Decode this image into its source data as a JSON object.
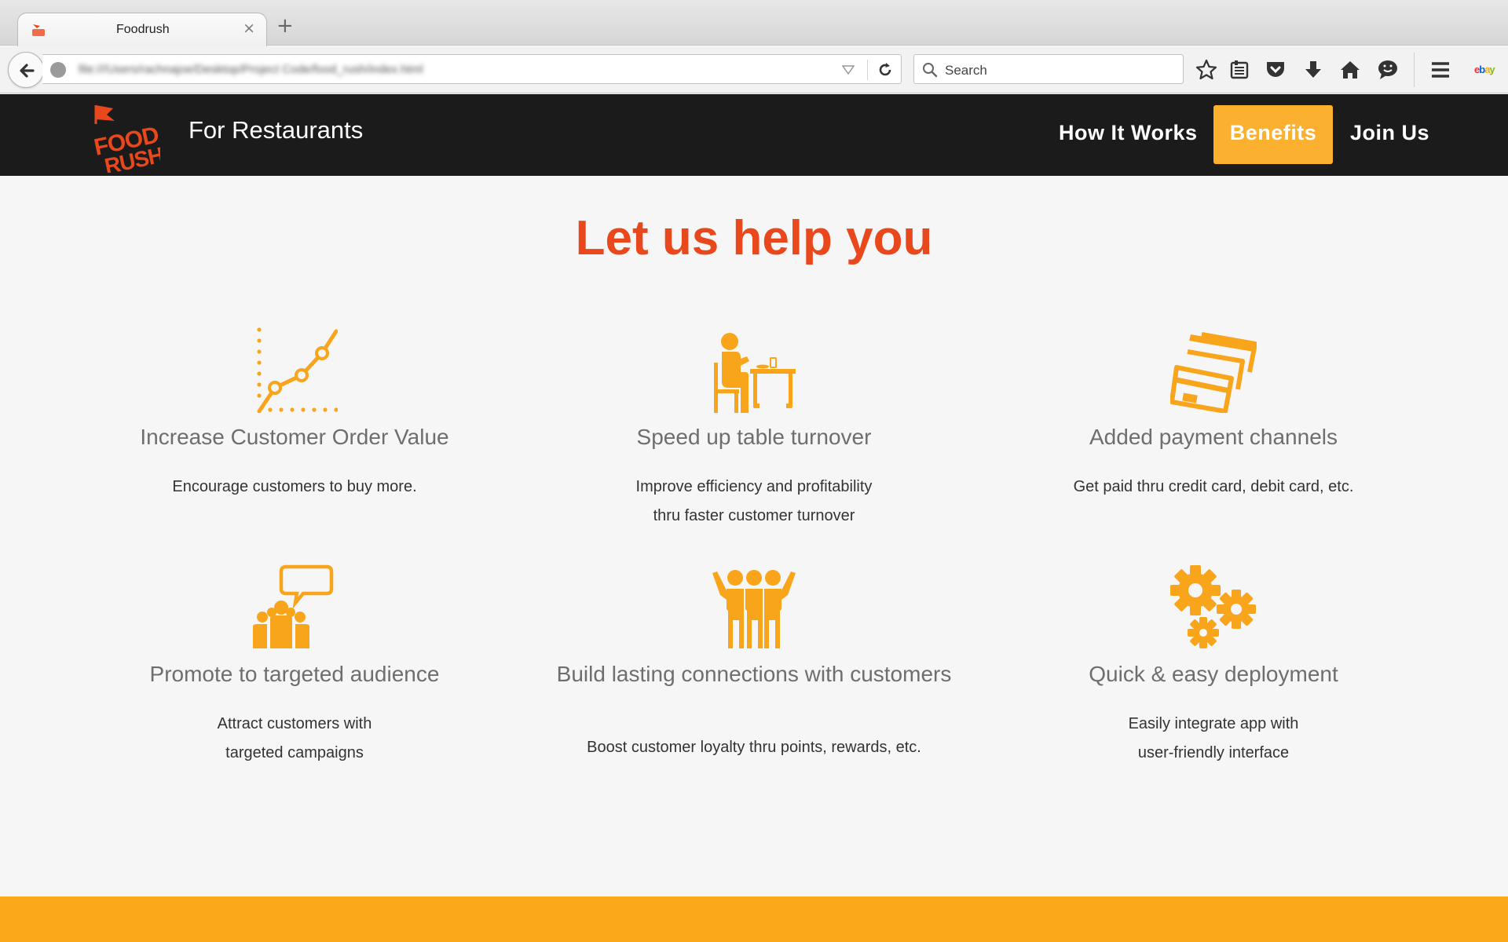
{
  "browser": {
    "tab_title": "Foodrush",
    "tab_close": "×",
    "new_tab": "+",
    "url": "file:///Users/rachnajoe/Desktop/Project Code/food_rush/index.html",
    "search_placeholder": "Search",
    "toolbar_icons": [
      "bookmark-star-icon",
      "reading-list-icon",
      "pocket-icon",
      "download-icon",
      "home-icon",
      "chat-icon",
      "menu-icon"
    ],
    "search_engine": "ebay"
  },
  "site": {
    "logo_text": [
      "FOOD",
      "RUSH"
    ],
    "subtitle": "For Restaurants",
    "nav": [
      {
        "label": "How It Works",
        "active": false
      },
      {
        "label": "Benefits",
        "active": true
      },
      {
        "label": "Join Us",
        "active": false
      }
    ],
    "colors": {
      "header": "#1b1b1b",
      "accent": "#fbb02f",
      "headline": "#e8481b",
      "icon": "#f9a51b",
      "footer": "#fba91b"
    }
  },
  "main": {
    "headline": "Let us help you",
    "features": [
      {
        "icon": "growth-chart-icon",
        "title": "Increase Customer Order Value",
        "desc": [
          "Encourage customers to buy more."
        ]
      },
      {
        "icon": "diner-at-table-icon",
        "title": "Speed up table turnover",
        "desc": [
          "Improve efficiency and profitability",
          "thru faster customer turnover"
        ]
      },
      {
        "icon": "credit-cards-icon",
        "title": "Added payment channels",
        "desc": [
          "Get paid thru credit card, debit card, etc."
        ]
      },
      {
        "icon": "audience-speech-icon",
        "title": "Promote to targeted audience",
        "desc": [
          "Attract customers with",
          "targeted campaigns"
        ]
      },
      {
        "icon": "group-of-friends-icon",
        "title": "Build lasting connections with customers",
        "desc": [
          "Boost customer loyalty thru points, rewards, etc."
        ]
      },
      {
        "icon": "gears-icon",
        "title": "Quick & easy deployment",
        "desc": [
          "Easily integrate app with",
          "user-friendly interface"
        ]
      }
    ]
  }
}
